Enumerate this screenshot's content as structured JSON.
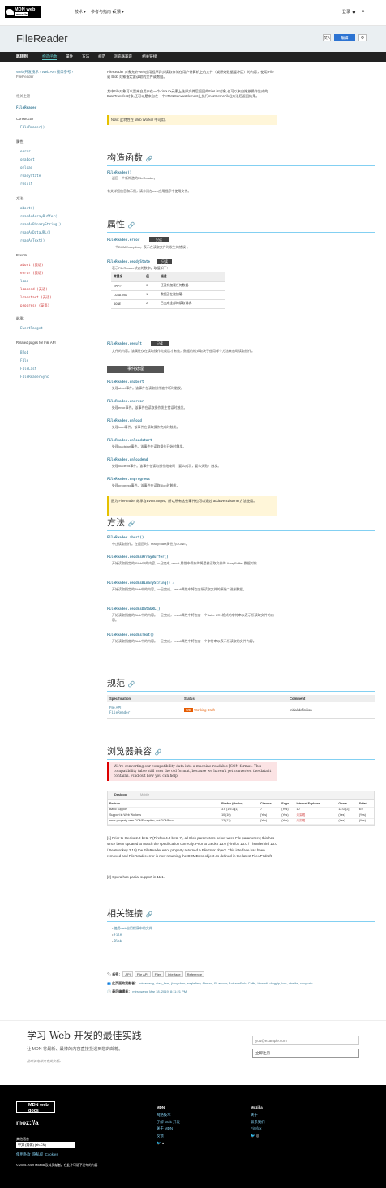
{
  "header": {
    "logo": "MDN web docs",
    "logo_sub": "moz://a",
    "nav": [
      "技术 ▾",
      "参考与指南 ▾",
      "反馈 ▾"
    ],
    "login": "登录"
  },
  "hero": {
    "title": "FileReader",
    "edit": "编辑",
    "lang": "文A"
  },
  "jumpbar": {
    "label": "跳转到:",
    "items": [
      "构造函数",
      "属性",
      "方法",
      "规范",
      "浏览器兼容",
      "相关链接"
    ]
  },
  "breadcrumb": [
    "Web 开发技术 ›",
    "Web API 接口参考 ›",
    "FileReader"
  ],
  "sidebar": {
    "title": "相关主题",
    "root": "FileReader",
    "constructor": "Constructor",
    "ctor": "FileReader()",
    "props": "属性",
    "prop_items": [
      "error",
      "onabort",
      "onload",
      "readyState",
      "result"
    ],
    "methods": "方法",
    "method_items": [
      "abort()",
      "readAsArrayBuffer()",
      "readAsBinaryString()",
      "readAsDataURL()",
      "readAsText()"
    ],
    "events": "Events",
    "event_items": [
      "abort (英语)",
      "error (英语)",
      "load",
      "loadend (英语)",
      "loadstart (英语)",
      "progress (英语)"
    ],
    "inherit": "继承:",
    "inherit_item": "EventTarget",
    "related": "Related pages for File API",
    "related_items": [
      "Blob",
      "File",
      "FileList",
      "FileReaderSync"
    ]
  },
  "intro": "FileReader 对象允许Web应用程序异步读取存储在用户计算机上的文件（或原始数据缓冲区）的内容，使用 File 或 Blob 对象指定要读取的文件或数据。",
  "intro2": "其中File对象可以是来自用户在一个<input>元素上选择文件后返回的FileList对象,也可以来自拖放操作生成的 DataTransfer对象,还可以是来自在一个HTMLCanvasElement上执行mozGetAsFile()方法后返回结果。",
  "note": "Note: 此特性在 Web Worker 中可用。",
  "sections": {
    "ctor": "构造函数",
    "props": "属性",
    "methods": "方法",
    "spec": "规范",
    "compat": "浏览器兼容",
    "related": "相关链接"
  },
  "ctor": {
    "name": "FileReader()",
    "desc": "返回一个新构造的FileReader。",
    "more": "有关详细信息和示例，请参阅在web应用程序中使用文件。"
  },
  "props": [
    {
      "name": "FileReader.error",
      "badge": "只读",
      "desc": "一个DOMException，表示在读取文件时发生的错误 。"
    },
    {
      "name": "FileReader.readyState",
      "badge": "只读",
      "desc": "表示FileReader状态的数字。取值如下："
    },
    {
      "name": "FileReader.result",
      "badge": "只读",
      "desc": "文件的内容。该属性仅在读取操作完成后才有效，数据的格式取决于使用哪个方法来启动读取操作。"
    }
  ],
  "states": {
    "head": [
      "常量名",
      "值",
      "描述"
    ],
    "rows": [
      [
        "EMPTY",
        "0",
        "还没有加载任何数据."
      ],
      [
        "LOADING",
        "1",
        "数据正在被加载."
      ],
      [
        "DONE",
        "2",
        "已完成全部的读取请求."
      ]
    ]
  },
  "events_title": "事件处理",
  "events": [
    {
      "name": "FileReader.onabort",
      "desc": "处理abort事件。该事件在读取操作被中断时触发。"
    },
    {
      "name": "FileReader.onerror",
      "desc": "处理error事件。该事件在读取操作发生错误时触发。"
    },
    {
      "name": "FileReader.onload",
      "desc": "处理load事件。该事件在读取操作完成时触发。"
    },
    {
      "name": "FileReader.onloadstart",
      "desc": "处理loadstart事件。该事件在读取操作开始时触发。"
    },
    {
      "name": "FileReader.onloadend",
      "desc": "处理loadend事件。该事件在读取操作结束时（要么成功，要么失败）触发。"
    },
    {
      "name": "FileReader.onprogress",
      "desc": "处理progress事件。该事件在读取Blob时触发。"
    }
  ],
  "events_note": "因为 FileReader 继承自EventTarget，所以所有这些事件也可以通过 addEventListener方法使用。",
  "methods": [
    {
      "name": "FileReader.abort()",
      "desc": "中止读取操作。在返回时，readyState属性为DONE。"
    },
    {
      "name": "FileReader.readAsArrayBuffer()",
      "desc": "开始读取指定的 Blob中的内容, 一旦完成, result 属性中保存的将是被读取文件的 ArrayBuffer 数据对象."
    },
    {
      "name": "FileReader.readAsBinaryString() ⚠",
      "desc": "开始读取指定的Blob中的内容。一旦完成，result属性中将包含所读取文件的原始二进制数据。"
    },
    {
      "name": "FileReader.readAsDataURL()",
      "desc": "开始读取指定的Blob中的内容。一旦完成，result属性中将包含一个data: URL格式的字符串以表示所读取文件的内容。"
    },
    {
      "name": "FileReader.readAsText()",
      "desc": "开始读取指定的Blob中的内容。一旦完成，result属性中将包含一个字符串以表示所读取的文件内容。"
    }
  ],
  "spec": {
    "head": [
      "Specification",
      "Status",
      "Comment"
    ],
    "row": [
      "File API",
      "WD",
      "Working Draft",
      "Initial definition"
    ],
    "row_sub": "FileReader"
  },
  "compat": {
    "alert": "We're converting our compatibility data into a machine-readable JSON format. This compatibility table still uses the old format, because we haven't yet converted the data it contains. Find out how you can help!",
    "tabs": [
      "Desktop",
      "Mobile"
    ],
    "head": [
      "Feature",
      "Firefox (Gecko)",
      "Chrome",
      "Edge",
      "Internet Explorer",
      "Opera",
      "Safari"
    ],
    "rows": [
      [
        "Basic support",
        "3.6 (1.9.2)[1]",
        "7",
        "(Yes)",
        "10",
        "12.02[2]",
        "6.0"
      ],
      [
        "Support in Web Workers",
        "10 (10)",
        "(Yes)",
        "(Yes)",
        "未实现",
        "(Yes)",
        "(Yes)"
      ],
      [
        "error property uses DOMException, not DOMError",
        "13 (13)",
        "(Yes)",
        "(Yes)",
        "未实现",
        "(Yes)",
        "(Yes)"
      ]
    ]
  },
  "footnote1": "[1] Prior to Gecko 2.0 beta 7 (Firefox 4.0 beta 7), all Blob parameters below were File parameters; this has since been updated to match the specification correctly. Prior to Gecko 13.0 (Firefox 13.0 / Thunderbird 13.0 / SeaMonkey 2.10) the FileReader.error property returned a FileError object. This interface has been removed and FileReader.error is now returning the DOMError object as defined in the latest FileAPI draft.",
  "footnote2": "[2] Opera has partial support in 11.1.",
  "related_links": [
    "使用web应用程序中的文件",
    "File",
    "Blob"
  ],
  "tags_label": "标签：",
  "tags": [
    "API",
    "File API",
    "Files",
    "Interface",
    "Reference"
  ],
  "contrib_label": "此页面的贡献者：",
  "contrib": "mirrawang, xiao_liam, jiangchen, eagleflew, Ahmad, PLamour, AutumnFish, Caffe, hbwadi, dingyip, lcm, charlie, zouyuxin",
  "updated_label": "最后编辑者：",
  "updated": "mirrawang, Mar 18, 2019, 8:11:21 PM",
  "newsletter": {
    "title": "学习 Web 开发的最佳实践",
    "desc": "让 MDN 将最新、最棒的内容直接投递到您的邮箱。",
    "note": "此时该电邮只有英文版。",
    "placeholder": "you@example.com",
    "button": "立即注册"
  },
  "footer": {
    "logo": "MDN web docs",
    "moz": "moz://a",
    "lang_label": "其他语言",
    "lang": "中文 (简体) (zh-CN)",
    "links1": [
      "使用条款",
      "隐私权",
      "Cookies"
    ],
    "copy": "© 2005-2019 Mozilla 及其贡献者。在此许可证下发布的内容",
    "mdn_title": "MDN",
    "mdn_links": [
      "网络技术",
      "了解 Web 开发",
      "关于 MDN",
      "反馈"
    ],
    "moz_title": "Mozilla",
    "moz_links": [
      "关于",
      "联系我们",
      "Firefox"
    ]
  }
}
